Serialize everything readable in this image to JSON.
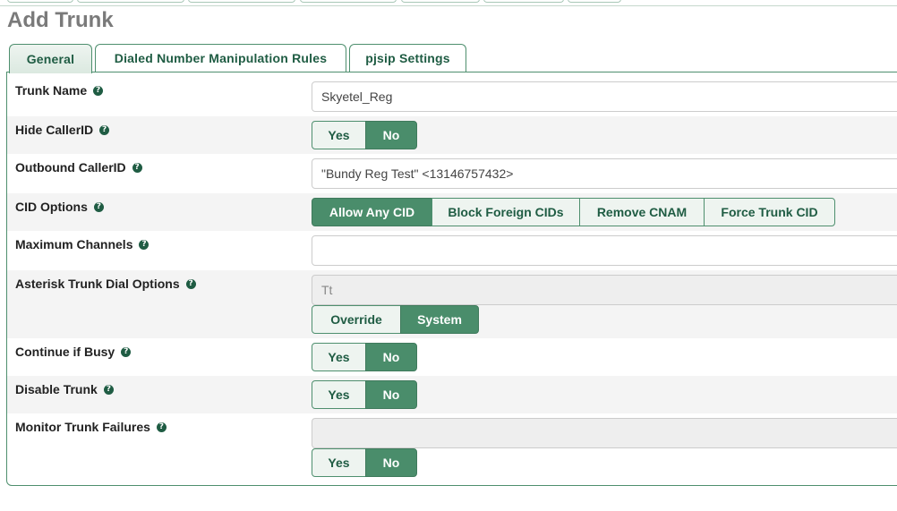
{
  "page": {
    "title": "Add Trunk"
  },
  "tabs": [
    {
      "label": "General"
    },
    {
      "label": "Dialed Number Manipulation Rules"
    },
    {
      "label": "pjsip Settings"
    }
  ],
  "fields": {
    "trunk_name": {
      "label": "Trunk Name",
      "value": "Skyetel_Reg"
    },
    "hide_callerid": {
      "label": "Hide CallerID",
      "yes": "Yes",
      "no": "No",
      "selected": "No"
    },
    "outbound_callerid": {
      "label": "Outbound CallerID",
      "value": "\"Bundy Reg Test\" <13146757432>"
    },
    "cid_options": {
      "label": "CID Options",
      "options": [
        "Allow Any CID",
        "Block Foreign CIDs",
        "Remove CNAM",
        "Force Trunk CID"
      ],
      "selected": "Allow Any CID"
    },
    "max_channels": {
      "label": "Maximum Channels",
      "value": ""
    },
    "dial_options": {
      "label": "Asterisk Trunk Dial Options",
      "value": "Tt",
      "override": "Override",
      "system": "System",
      "selected": "System"
    },
    "continue_busy": {
      "label": "Continue if Busy",
      "yes": "Yes",
      "no": "No",
      "selected": "No"
    },
    "disable_trunk": {
      "label": "Disable Trunk",
      "yes": "Yes",
      "no": "No",
      "selected": "No"
    },
    "monitor_failures": {
      "label": "Monitor Trunk Failures",
      "value": "",
      "yes": "Yes",
      "no": "No",
      "selected": "No"
    }
  },
  "help_glyph": "?",
  "colors": {
    "accent": "#4a8d6b",
    "tab_text": "#1f5c43",
    "title": "#7a7a7a",
    "border": "#4e8f6e"
  }
}
